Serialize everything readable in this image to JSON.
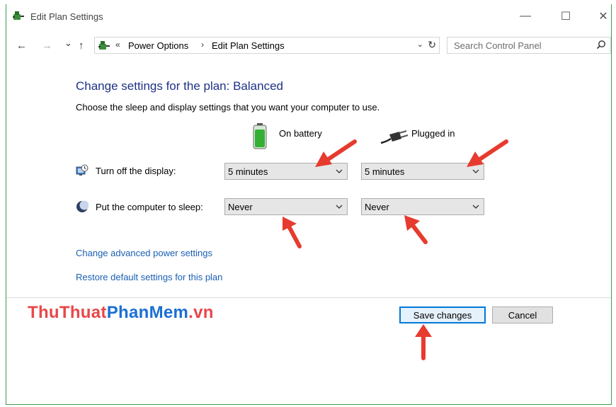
{
  "window": {
    "title": "Edit Plan Settings",
    "controls": {
      "minimize": "—",
      "maximize": "☐",
      "close": "✕"
    }
  },
  "address_bar": {
    "back": "←",
    "forward": "→",
    "recent": "⌄",
    "up": "↑",
    "overflow": "«",
    "crumbs": [
      "Power Options",
      "Edit Plan Settings"
    ],
    "crumb_separator": "›",
    "dropdown": "⌄",
    "refresh": "↻"
  },
  "search": {
    "placeholder": "Search Control Panel"
  },
  "main": {
    "heading": "Change settings for the plan: Balanced",
    "description": "Choose the sleep and display settings that you want your computer to use.",
    "columns": {
      "battery": "On battery",
      "plugged": "Plugged in"
    },
    "rows": [
      {
        "label": "Turn off the display:",
        "battery": "5 minutes",
        "plugged": "5 minutes"
      },
      {
        "label": "Put the computer to sleep:",
        "battery": "Never",
        "plugged": "Never"
      }
    ],
    "links": {
      "advanced": "Change advanced power settings",
      "restore": "Restore default settings for this plan"
    }
  },
  "footer": {
    "save": "Save changes",
    "cancel": "Cancel"
  },
  "watermark": {
    "part1": "ThuThuat",
    "part2": "PhanMem",
    "part3": ".vn"
  },
  "colors": {
    "heading": "#1e3287",
    "link": "#1a5fb4",
    "annotation_arrow": "#e63b2e",
    "window_border": "#3c9a4a",
    "watermark_red": "#e8474a",
    "watermark_blue": "#1a6fd4"
  }
}
